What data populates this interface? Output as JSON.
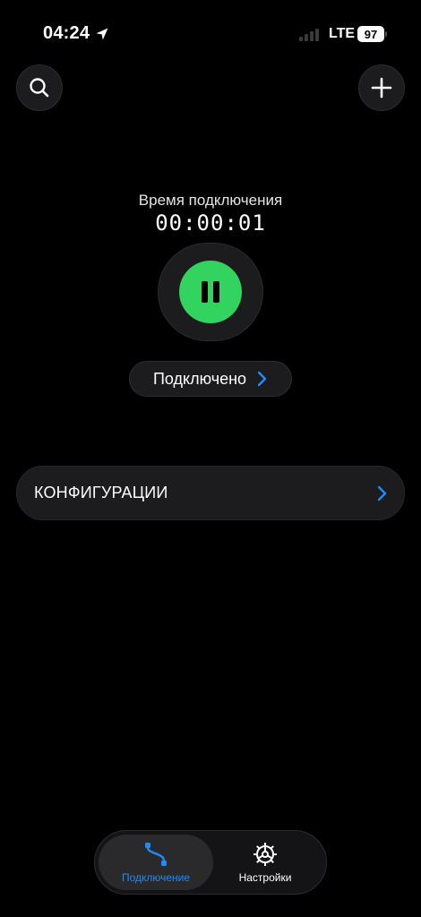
{
  "status_bar": {
    "time": "04:24",
    "network": "LTE",
    "battery": "97",
    "location_icon": "location-arrow-icon"
  },
  "header": {
    "search_icon": "search-icon",
    "add_icon": "plus-icon"
  },
  "connection": {
    "label": "Время подключения",
    "elapsed": "00:00:01",
    "power_icon": "pause-icon",
    "accent_color": "#32d35e",
    "status_text": "Подключено"
  },
  "configurations": {
    "label": "КОНФИГУРАЦИИ",
    "chevron_color": "#1d8cf8"
  },
  "tabs": [
    {
      "label": "Подключение",
      "icon": "connection-route-icon",
      "active": true
    },
    {
      "label": "Настройки",
      "icon": "settings-gear-icon",
      "active": false
    }
  ],
  "colors": {
    "background": "#000000",
    "surface": "#1c1c1e",
    "accent_blue": "#1d8cf8",
    "accent_green": "#32d35e"
  }
}
